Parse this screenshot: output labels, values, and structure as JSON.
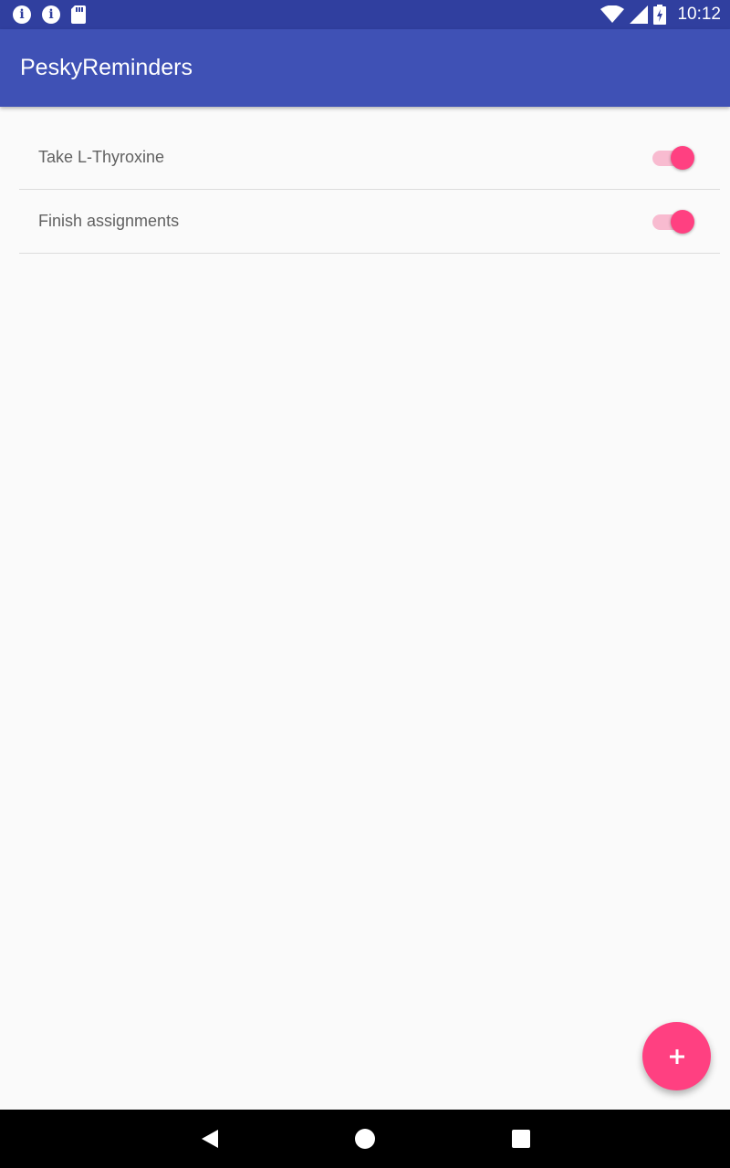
{
  "status_bar": {
    "time": "10:12",
    "left_icons": [
      "info-icon",
      "info-icon",
      "sd-card-icon"
    ],
    "right_icons": [
      "wifi-icon",
      "cell-signal-icon",
      "battery-charging-icon"
    ]
  },
  "app_bar": {
    "title": "PeskyReminders"
  },
  "reminders": [
    {
      "label": "Take L-Thyroxine",
      "enabled": true
    },
    {
      "label": "Finish assignments",
      "enabled": true
    }
  ],
  "fab": {
    "icon": "plus-icon"
  },
  "nav_bar": {
    "icons": [
      "back-icon",
      "home-icon",
      "recents-icon"
    ]
  },
  "colors": {
    "status_bar": "#303f9f",
    "app_bar": "#3f51b5",
    "accent": "#ff4081",
    "switch_track": "#f8bbd0",
    "background": "#fafafa"
  }
}
